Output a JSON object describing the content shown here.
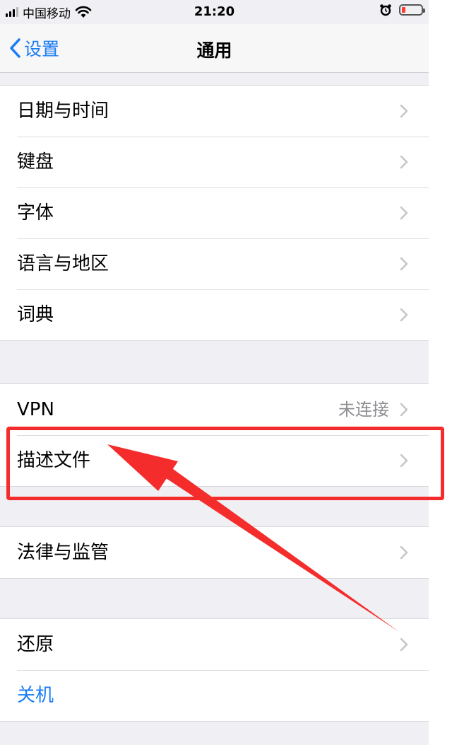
{
  "status_bar": {
    "carrier": "中国移动",
    "time": "21:20"
  },
  "nav": {
    "back_label": "设置",
    "title": "通用"
  },
  "groups": [
    {
      "rows": [
        {
          "label": "日期与时间"
        },
        {
          "label": "键盘"
        },
        {
          "label": "字体"
        },
        {
          "label": "语言与地区"
        },
        {
          "label": "词典"
        }
      ]
    },
    {
      "rows": [
        {
          "label": "VPN",
          "value": "未连接"
        },
        {
          "label": "描述文件"
        }
      ]
    },
    {
      "rows": [
        {
          "label": "法律与监管"
        }
      ]
    },
    {
      "rows": [
        {
          "label": "还原"
        },
        {
          "label": "关机"
        }
      ]
    }
  ],
  "colors": {
    "accent": "#1a7cf5",
    "annotation": "#f42c2c",
    "battery_low": "#ff3b30"
  }
}
